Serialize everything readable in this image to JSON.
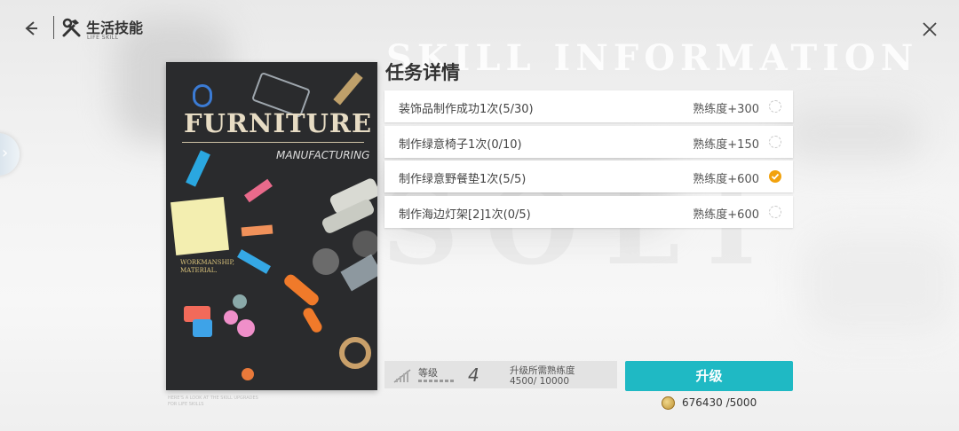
{
  "header": {
    "title": "生活技能",
    "title_en": "LIFE SKILL"
  },
  "background": {
    "title": "SKILL INFORMATION",
    "big_text": "SOLI"
  },
  "poster": {
    "title": "FURNITURE",
    "subtitle": "MANUFACTURING",
    "work_heading_1": "WORKMANSHIP,",
    "work_heading_2": "MATERIAL.",
    "caption_1": "HERE'S A LOOK AT THE SKILL UPGRADES",
    "caption_2": "FOR LIFE SKILLS"
  },
  "tasks": {
    "heading": "任务详情",
    "items": [
      {
        "name": "装饰品制作成功1次(5/30)",
        "reward": "熟练度+300",
        "done": false
      },
      {
        "name": "制作绿意椅子1次(0/10)",
        "reward": "熟练度+150",
        "done": false
      },
      {
        "name": "制作绿意野餐垫1次(5/5)",
        "reward": "熟练度+600",
        "done": true
      },
      {
        "name": "制作海边灯架[2]1次(0/5)",
        "reward": "熟练度+600",
        "done": false
      }
    ]
  },
  "level": {
    "label": "等级",
    "value": "4",
    "need_label": "升级所需熟练度",
    "need_value": "4500/ 10000"
  },
  "upgrade": {
    "button_label": "升级",
    "currency_text": "676430 /5000"
  },
  "colors": {
    "accent": "#1fb9c4",
    "done": "#f2a20d"
  },
  "icons": {
    "back": "arrow-left-icon",
    "tools": "hammer-wrench-icon",
    "close": "close-icon",
    "coin": "coin-icon",
    "check": "check-icon",
    "level": "level-bars-icon"
  }
}
